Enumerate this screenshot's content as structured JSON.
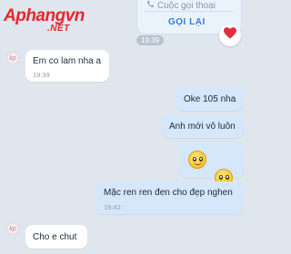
{
  "watermark": {
    "brand": "Aphang",
    "suffix": "vn",
    "sub": ".NET"
  },
  "call_card": {
    "title": "Cuộc gọi thoại",
    "action": "GỌI LẠI",
    "time": "19:39"
  },
  "avatar_initials": "kp",
  "messages": [
    {
      "text": "Em co lam nha a",
      "time": "19:39"
    },
    {
      "text": "Oke 105 nha"
    },
    {
      "text": "Anh mới vô luôn"
    },
    {
      "text": "Mặc ren ren đen cho đẹp nghen",
      "time": "19:42"
    },
    {
      "text": "Cho e chut"
    }
  ],
  "colors": {
    "background": "#dfe6ee",
    "outgoing": "#d5e7fb",
    "incoming": "#ffffff",
    "accent": "#2f7fd8",
    "logo": "#e8252a"
  },
  "icons": {
    "call": "phone-icon",
    "reaction": "heart-icon",
    "emoji": "smiling-face-emoji"
  }
}
